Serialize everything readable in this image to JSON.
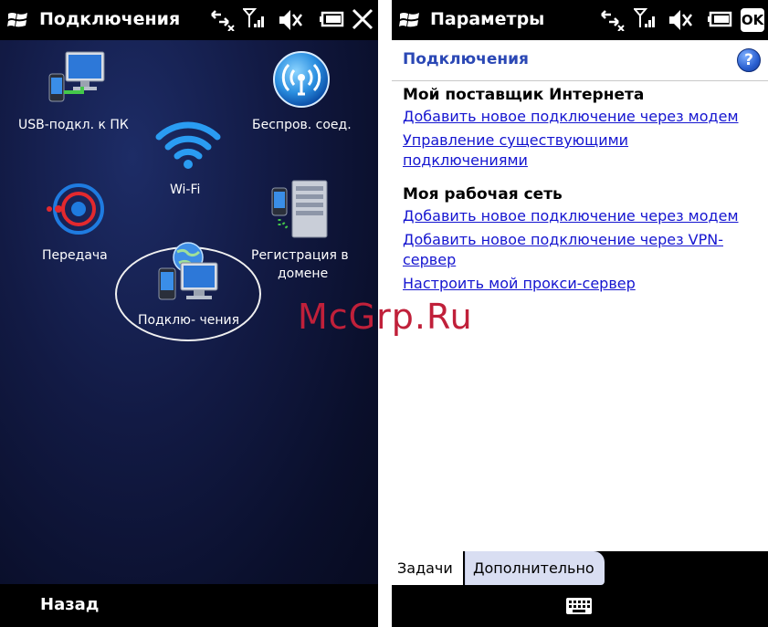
{
  "left_screen": {
    "title": "Подключения",
    "tiles": [
      {
        "label": "USB-подкл. к ПК"
      },
      {
        "label": "Беспров. соед."
      },
      {
        "label": "Wi-Fi"
      },
      {
        "label": "Передача"
      },
      {
        "label": "Регистрация в",
        "label2": "домене"
      },
      {
        "label": "Подклю- чения"
      }
    ],
    "softkey_left": "Назад"
  },
  "right_screen": {
    "title": "Параметры",
    "ok_label": "OK",
    "page_title": "Подключения",
    "help_label": "?",
    "sections": [
      {
        "heading": "Мой поставщик Интернета",
        "links": [
          {
            "line1": "Добавить новое подключение через модем",
            "line2": ""
          },
          {
            "line1": "Управление существующими",
            "line2": "подключениями"
          }
        ]
      },
      {
        "heading": "Моя рабочая сеть",
        "links": [
          {
            "line1": "Добавить новое подключение через модем",
            "line2": ""
          },
          {
            "line1": "Добавить новое подключение через VPN-",
            "line2": "сервер"
          },
          {
            "line1": "Настроить мой прокси-сервер",
            "line2": ""
          }
        ]
      }
    ],
    "tabs": [
      {
        "label": "Задачи",
        "active": true
      },
      {
        "label": "Дополнительно",
        "active": false
      }
    ]
  },
  "watermark": "McGrp.Ru",
  "colors": {
    "link": "#1515d0",
    "page_title": "#2b48b5",
    "watermark": "#c0203a"
  }
}
